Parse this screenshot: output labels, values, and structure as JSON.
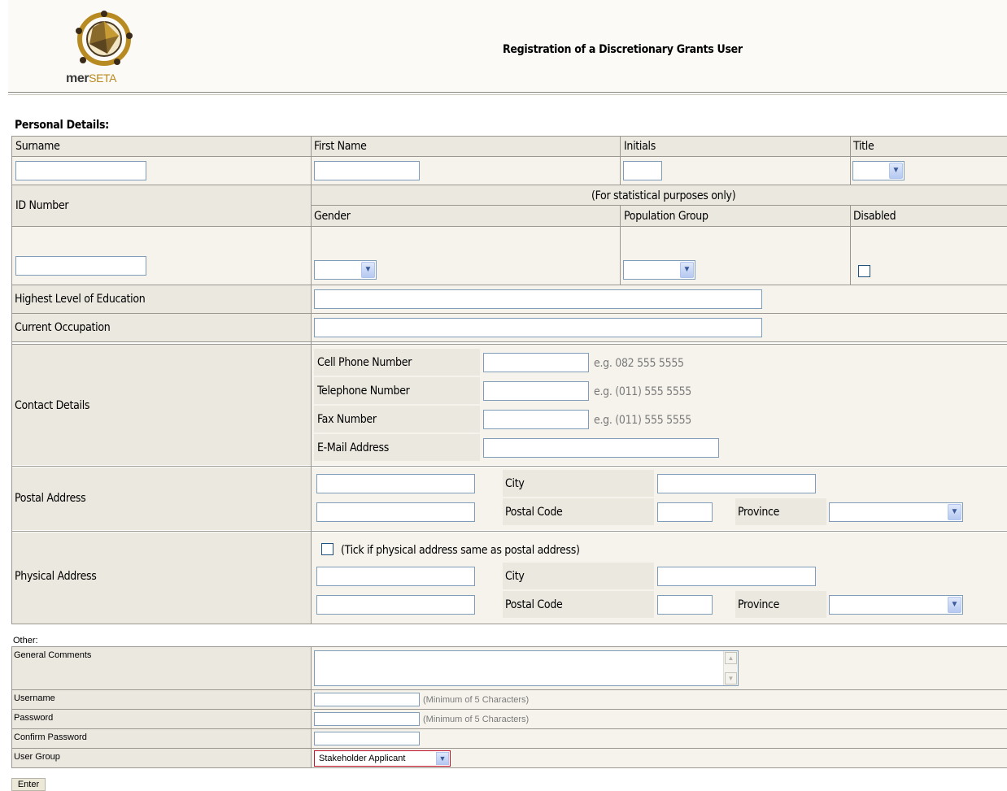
{
  "header": {
    "logo_text_bold": "mer",
    "logo_text_light": "SETA",
    "title": "Registration of a Discretionary Grants User"
  },
  "personal": {
    "section_title": "Personal Details:",
    "surname_label": "Surname",
    "first_name_label": "First Name",
    "initials_label": "Initials",
    "title_label": "Title",
    "id_number_label": "ID Number",
    "statistical_note": "(For statistical purposes only)",
    "gender_label": "Gender",
    "population_group_label": "Population Group",
    "disabled_label": "Disabled",
    "education_label": "Highest Level of Education",
    "occupation_label": "Current Occupation"
  },
  "contact": {
    "label": "Contact Details",
    "cell_label": "Cell Phone Number",
    "cell_hint": "e.g. 082 555 5555",
    "tel_label": "Telephone Number",
    "tel_hint": "e.g. (011) 555 5555",
    "fax_label": "Fax Number",
    "fax_hint": "e.g. (011) 555 5555",
    "email_label": "E-Mail Address"
  },
  "postal": {
    "label": "Postal Address",
    "city_label": "City",
    "postal_code_label": "Postal Code",
    "province_label": "Province"
  },
  "physical": {
    "label": "Physical Address",
    "same_as_postal": "(Tick if physical address same as postal address)",
    "city_label": "City",
    "postal_code_label": "Postal Code",
    "province_label": "Province"
  },
  "other": {
    "section_title": "Other:",
    "comments_label": "General Comments",
    "username_label": "Username",
    "username_hint": "(Minimum of 5 Characters)",
    "password_label": "Password",
    "password_hint": "(Minimum of 5 Characters)",
    "confirm_password_label": "Confirm Password",
    "user_group_label": "User Group",
    "user_group_value": "Stakeholder Applicant"
  },
  "enter_button": "Enter"
}
